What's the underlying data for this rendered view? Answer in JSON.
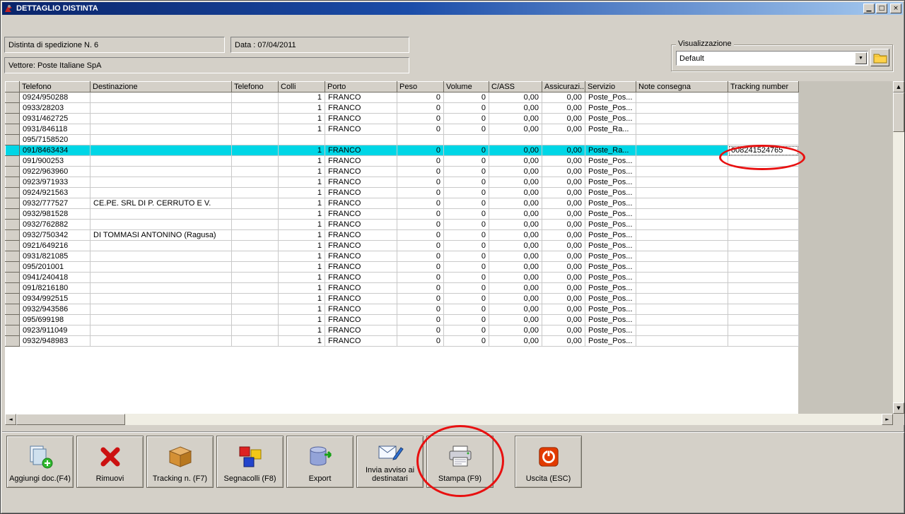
{
  "window": {
    "title": "DETTAGLIO DISTINTA"
  },
  "icons": {
    "minimize": "▁",
    "restore": "□",
    "close": "×",
    "dropdown_arrow": "▼",
    "scroll_up": "▲",
    "scroll_down": "▼",
    "scroll_left": "◄",
    "scroll_right": "►"
  },
  "form": {
    "distinta": "Distinta di spedizione N. 6",
    "data": "Data : 07/04/2011",
    "vettore": "Vettore: Poste Italiane SpA",
    "visualizzazione_label": "Visualizzazione",
    "visualizzazione_value": "Default"
  },
  "grid": {
    "columns": [
      "Telefono",
      "Destinazione",
      "Telefono",
      "Colli",
      "Porto",
      "Peso",
      "Volume",
      "C/ASS",
      "Assicurazi...",
      "Servizio",
      "Note consegna",
      "Tracking number"
    ],
    "selected_index": 5,
    "rows": [
      [
        "0924/950288",
        "",
        "",
        "1",
        "FRANCO",
        "0",
        "0",
        "0,00",
        "0,00",
        "Poste_Pos...",
        "",
        ""
      ],
      [
        "0933/28203",
        "",
        "",
        "1",
        "FRANCO",
        "0",
        "0",
        "0,00",
        "0,00",
        "Poste_Pos...",
        "",
        ""
      ],
      [
        "0931/462725",
        "",
        "",
        "1",
        "FRANCO",
        "0",
        "0",
        "0,00",
        "0,00",
        "Poste_Pos...",
        "",
        ""
      ],
      [
        "0931/846118",
        "",
        "",
        "1",
        "FRANCO",
        "0",
        "0",
        "0,00",
        "0,00",
        "Poste_Ra...",
        "",
        ""
      ],
      [
        "095/7158520",
        "",
        "",
        "",
        "",
        "",
        "",
        "",
        "",
        "",
        "",
        ""
      ],
      [
        "091/8463434",
        "",
        "",
        "1",
        "FRANCO",
        "0",
        "0",
        "0,00",
        "0,00",
        "Poste_Ra...",
        "",
        "008241524765"
      ],
      [
        "091/900253",
        "",
        "",
        "1",
        "FRANCO",
        "0",
        "0",
        "0,00",
        "0,00",
        "Poste_Pos...",
        "",
        ""
      ],
      [
        "0922/963960",
        "",
        "",
        "1",
        "FRANCO",
        "0",
        "0",
        "0,00",
        "0,00",
        "Poste_Pos...",
        "",
        ""
      ],
      [
        "0923/971933",
        "",
        "",
        "1",
        "FRANCO",
        "0",
        "0",
        "0,00",
        "0,00",
        "Poste_Pos...",
        "",
        ""
      ],
      [
        "0924/921563",
        "",
        "",
        "1",
        "FRANCO",
        "0",
        "0",
        "0,00",
        "0,00",
        "Poste_Pos...",
        "",
        ""
      ],
      [
        "0932/777527",
        "CE.PE. SRL DI P. CERRUTO E V.",
        "",
        "1",
        "FRANCO",
        "0",
        "0",
        "0,00",
        "0,00",
        "Poste_Pos...",
        "",
        ""
      ],
      [
        "0932/981528",
        "",
        "",
        "1",
        "FRANCO",
        "0",
        "0",
        "0,00",
        "0,00",
        "Poste_Pos...",
        "",
        ""
      ],
      [
        "0932/762882",
        "",
        "",
        "1",
        "FRANCO",
        "0",
        "0",
        "0,00",
        "0,00",
        "Poste_Pos...",
        "",
        ""
      ],
      [
        "0932/750342",
        "DI TOMMASI ANTONINO (Ragusa)",
        "",
        "1",
        "FRANCO",
        "0",
        "0",
        "0,00",
        "0,00",
        "Poste_Pos...",
        "",
        ""
      ],
      [
        "0921/649216",
        "",
        "",
        "1",
        "FRANCO",
        "0",
        "0",
        "0,00",
        "0,00",
        "Poste_Pos...",
        "",
        ""
      ],
      [
        "0931/821085",
        "",
        "",
        "1",
        "FRANCO",
        "0",
        "0",
        "0,00",
        "0,00",
        "Poste_Pos...",
        "",
        ""
      ],
      [
        "095/201001",
        "",
        "",
        "1",
        "FRANCO",
        "0",
        "0",
        "0,00",
        "0,00",
        "Poste_Pos...",
        "",
        ""
      ],
      [
        "0941/240418",
        "",
        "",
        "1",
        "FRANCO",
        "0",
        "0",
        "0,00",
        "0,00",
        "Poste_Pos...",
        "",
        ""
      ],
      [
        "091/8216180",
        "",
        "",
        "1",
        "FRANCO",
        "0",
        "0",
        "0,00",
        "0,00",
        "Poste_Pos...",
        "",
        ""
      ],
      [
        "0934/992515",
        "",
        "",
        "1",
        "FRANCO",
        "0",
        "0",
        "0,00",
        "0,00",
        "Poste_Pos...",
        "",
        ""
      ],
      [
        "0932/943586",
        "",
        "",
        "1",
        "FRANCO",
        "0",
        "0",
        "0,00",
        "0,00",
        "Poste_Pos...",
        "",
        ""
      ],
      [
        "095/699198",
        "",
        "",
        "1",
        "FRANCO",
        "0",
        "0",
        "0,00",
        "0,00",
        "Poste_Pos...",
        "",
        ""
      ],
      [
        "0923/911049",
        "",
        "",
        "1",
        "FRANCO",
        "0",
        "0",
        "0,00",
        "0,00",
        "Poste_Pos...",
        "",
        ""
      ],
      [
        "0932/948983",
        "",
        "",
        "1",
        "FRANCO",
        "0",
        "0",
        "0,00",
        "0,00",
        "Poste_Pos...",
        "",
        ""
      ]
    ]
  },
  "toolbar": {
    "buttons": [
      {
        "name": "aggiungi-doc-button",
        "icon": "add-document-icon",
        "label": "Aggiungi doc.(F4)"
      },
      {
        "name": "rimuovi-button",
        "icon": "remove-icon",
        "label": "Rimuovi"
      },
      {
        "name": "tracking-button",
        "icon": "tracking-box-icon",
        "label": "Tracking n. (F7)"
      },
      {
        "name": "segnacolli-button",
        "icon": "parcel-labels-icon",
        "label": "Segnacolli (F8)"
      },
      {
        "name": "export-button",
        "icon": "export-database-icon",
        "label": "Export"
      },
      {
        "name": "invia-avviso-button",
        "icon": "send-notice-icon",
        "label": "Invia avviso ai destinatari"
      },
      {
        "name": "stampa-button",
        "icon": "printer-icon",
        "label": "Stampa (F9)"
      },
      {
        "name": "uscita-button",
        "icon": "exit-icon",
        "label": "Uscita (ESC)"
      }
    ]
  },
  "colors": {
    "selection": "#00d6e6",
    "annotation": "#e81010",
    "titlebar_start": "#0a246a",
    "titlebar_end": "#a6caf0"
  }
}
